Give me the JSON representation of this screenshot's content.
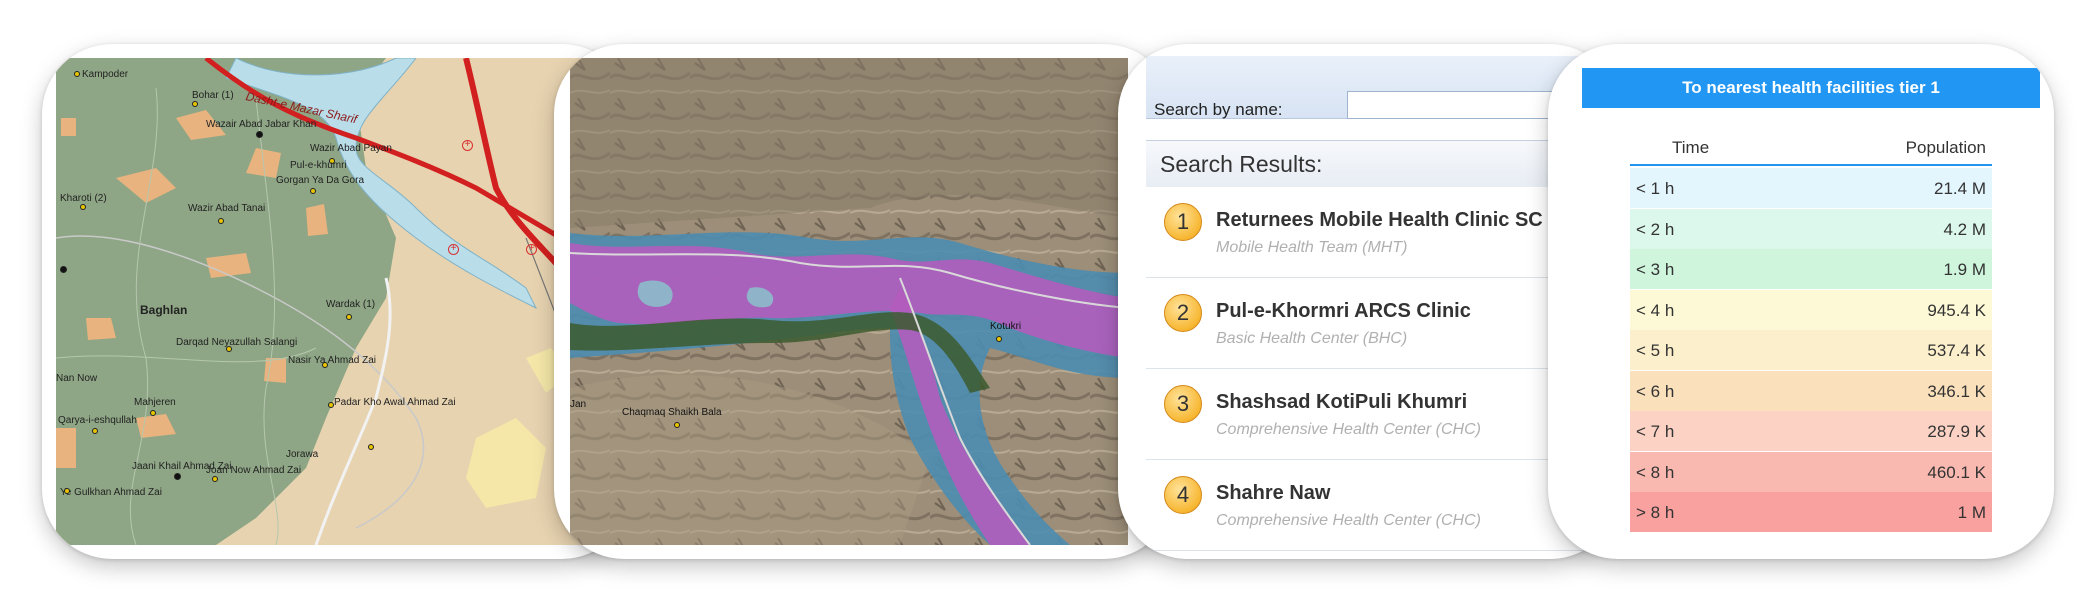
{
  "map1": {
    "region_label": "Baghlan",
    "river_label": "Dasht-e Mazar Sharif",
    "places": [
      "Kampoder",
      "Bohar (1)",
      "Wazair Abad Jabar Khan",
      "Wazir Abad Payan",
      "Pul-e-khumri",
      "Gorgan Ya Da Gora",
      "Kharoti (2)",
      "Wazir Abad Tanai",
      "Wardak (1)",
      "Darqad Neyazullah Salangi",
      "Nasir Ya Ahmad Zai",
      "Nan Now",
      "Mahjeren",
      "Padar Kho Awal Ahmad Zai",
      "Qarya-i-eshqullah",
      "Jaani Khail Ahmad Zai",
      "Joan Now Ahmad Zai",
      "Jorawa",
      "Ye Gulkhan Ahmad Zai"
    ]
  },
  "map2": {
    "places": [
      "Kotukri",
      "Chaqmaq Shaikh Bala",
      "Jan"
    ]
  },
  "search": {
    "label": "Search by name:",
    "input_value": "",
    "results_header": "Search Results:",
    "results": [
      {
        "num": "1",
        "title": "Returnees Mobile Health Clinic SC",
        "subtitle": "Mobile Health Team (MHT)"
      },
      {
        "num": "2",
        "title": "Pul-e-Khormri ARCS Clinic",
        "subtitle": "Basic Health Center (BHC)"
      },
      {
        "num": "3",
        "title": "Shashsad KotiPuli Khumri",
        "subtitle": "Comprehensive Health Center (CHC)"
      },
      {
        "num": "4",
        "title": "Shahre Naw",
        "subtitle": "Comprehensive Health Center (CHC)"
      }
    ]
  },
  "access": {
    "title": "To nearest health facilities tier 1",
    "col_time": "Time",
    "col_population": "Population",
    "rows": [
      {
        "time": "< 1 h",
        "population": "21.4 M",
        "color": "#e3f5fd"
      },
      {
        "time": "< 2 h",
        "population": "4.2 M",
        "color": "#dcf7ec"
      },
      {
        "time": "< 3 h",
        "population": "1.9 M",
        "color": "#cff5dd"
      },
      {
        "time": "< 4 h",
        "population": "945.4 K",
        "color": "#fdf8d6"
      },
      {
        "time": "< 5 h",
        "population": "537.4 K",
        "color": "#fcefcc"
      },
      {
        "time": "< 6 h",
        "population": "346.1 K",
        "color": "#fbe0bc"
      },
      {
        "time": "< 7 h",
        "population": "287.9 K",
        "color": "#fbd2c4"
      },
      {
        "time": "< 8 h",
        "population": "460.1 K",
        "color": "#fab9b0"
      },
      {
        "time": "> 8 h",
        "population": "1 M",
        "color": "#f8a19f"
      }
    ]
  }
}
